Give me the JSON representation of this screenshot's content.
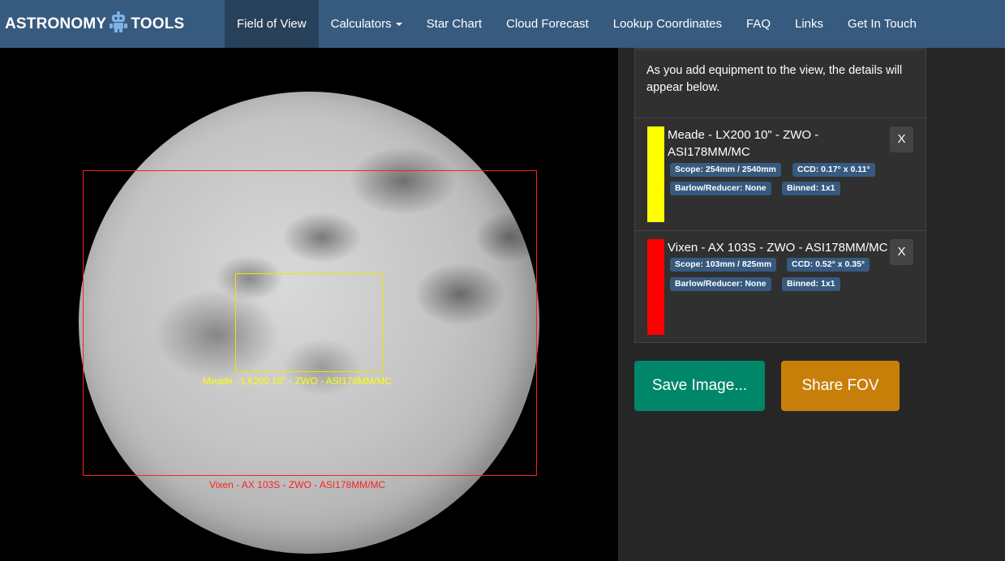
{
  "brand": {
    "left": "ASTRONOMY",
    "right": "TOOLS"
  },
  "nav": [
    {
      "label": "Field of View",
      "active": true
    },
    {
      "label": "Calculators",
      "dropdown": true
    },
    {
      "label": "Star Chart"
    },
    {
      "label": "Cloud Forecast"
    },
    {
      "label": "Lookup Coordinates"
    },
    {
      "label": "FAQ"
    },
    {
      "label": "Links"
    },
    {
      "label": "Get In Touch"
    }
  ],
  "fov": {
    "meade_label": "Meade - LX200 10\" - ZWO - ASI178MM/MC",
    "vixen_label": "Vixen - AX 103S - ZWO - ASI178MM/MC"
  },
  "panel": {
    "info": "As you add equipment to the view, the details will appear below.",
    "equipment": [
      {
        "title": "Meade - LX200 10\" - ZWO - ASI178MM/MC",
        "color": "#ffff00",
        "scope": "Scope: 254mm / 2540mm",
        "ccd": "CCD: 0.17° x 0.11°",
        "barlow": "Barlow/Reducer: None",
        "binned": "Binned: 1x1",
        "close": "X"
      },
      {
        "title": "Vixen - AX 103S - ZWO - ASI178MM/MC",
        "color": "#ff0000",
        "scope": "Scope: 103mm / 825mm",
        "ccd": "CCD: 0.52° x 0.35°",
        "barlow": "Barlow/Reducer: None",
        "binned": "Binned: 1x1",
        "close": "X"
      }
    ]
  },
  "buttons": {
    "save": "Save Image...",
    "share": "Share FOV"
  }
}
